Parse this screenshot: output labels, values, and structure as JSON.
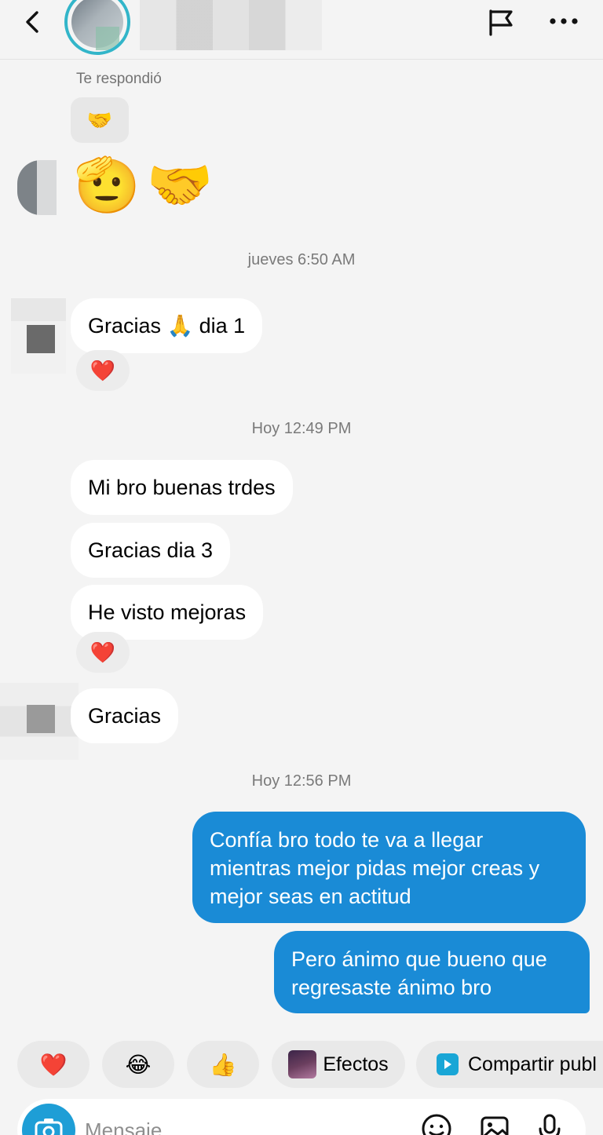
{
  "header": {
    "contact_name": "",
    "icons": [
      "back-arrow-icon",
      "flag-icon",
      "more-icon"
    ]
  },
  "thread": {
    "replied_label": "Te respondió",
    "replied_emoji": "🤝",
    "big_emojis": [
      "🫡",
      "🤝"
    ],
    "timestamp_1": "jueves 6:50 AM",
    "msg_1": "Gracias 🙏 dia 1",
    "reaction_1": "❤️",
    "timestamp_2": "Hoy 12:49 PM",
    "msg_2": "Mi bro buenas trdes",
    "msg_3": "Gracias dia 3",
    "msg_4": "He visto mejoras",
    "reaction_2": "❤️",
    "msg_5": "Gracias",
    "timestamp_3": "Hoy 12:56 PM",
    "out_1": "Confía bro todo te va a llegar mientras mejor pidas mejor creas y mejor seas en actitud",
    "out_2": "Pero ánimo que bueno que regresaste ánimo bro"
  },
  "quick_replies": {
    "heart": "❤️",
    "laugh": "😂",
    "thumbs": "👍",
    "effects": "Efectos",
    "share": "Compartir publ"
  },
  "composer": {
    "placeholder": "Mensaje...",
    "icons": [
      "camera-icon",
      "sticker-icon",
      "gallery-icon",
      "microphone-icon"
    ]
  },
  "colors": {
    "outgoing_bubble": "#1a8bd6",
    "incoming_bubble": "#ffffff",
    "background": "#f4f4f4",
    "story_ring": "#32b5c9"
  }
}
